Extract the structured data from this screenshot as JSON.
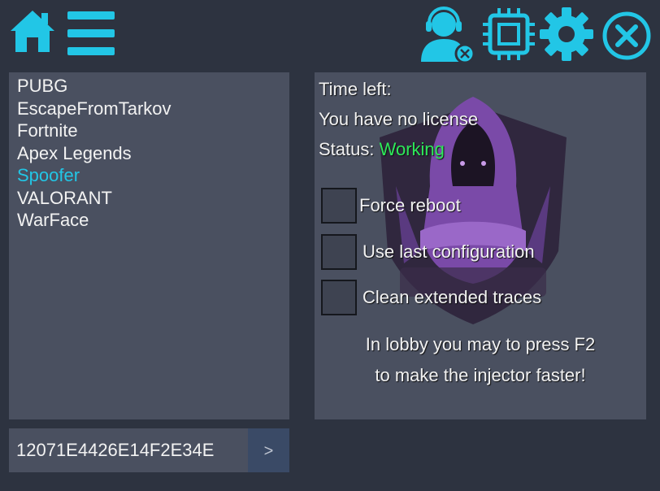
{
  "toolbar": {
    "left_icons": [
      "home-icon",
      "menu-icon"
    ],
    "right_icons": [
      "support-agent-icon",
      "cpu-chip-icon",
      "gear-icon",
      "close-icon"
    ],
    "accent_color": "#22c6e6"
  },
  "games": {
    "items": [
      "PUBG",
      "EscapeFromTarkov",
      "Fortnite",
      "Apex Legends",
      "Spoofer",
      "VALORANT",
      "WarFace"
    ],
    "selected": "Spoofer",
    "selected_color": "#22c6e6"
  },
  "info": {
    "time_left_label": "Time left:",
    "license_text": "You have no license",
    "status_label": "Status:",
    "status_value": "Working",
    "status_color": "#2ee85a"
  },
  "options": {
    "force_reboot": "Force reboot",
    "use_last_config": "Use last configuration",
    "clean_traces": "Clean extended traces"
  },
  "hint": {
    "line1": "In lobby you may to press F2",
    "line2": "to make the injector faster!"
  },
  "key_input": {
    "value": "12071E4426E14F2E34E",
    "button_label": ">"
  }
}
